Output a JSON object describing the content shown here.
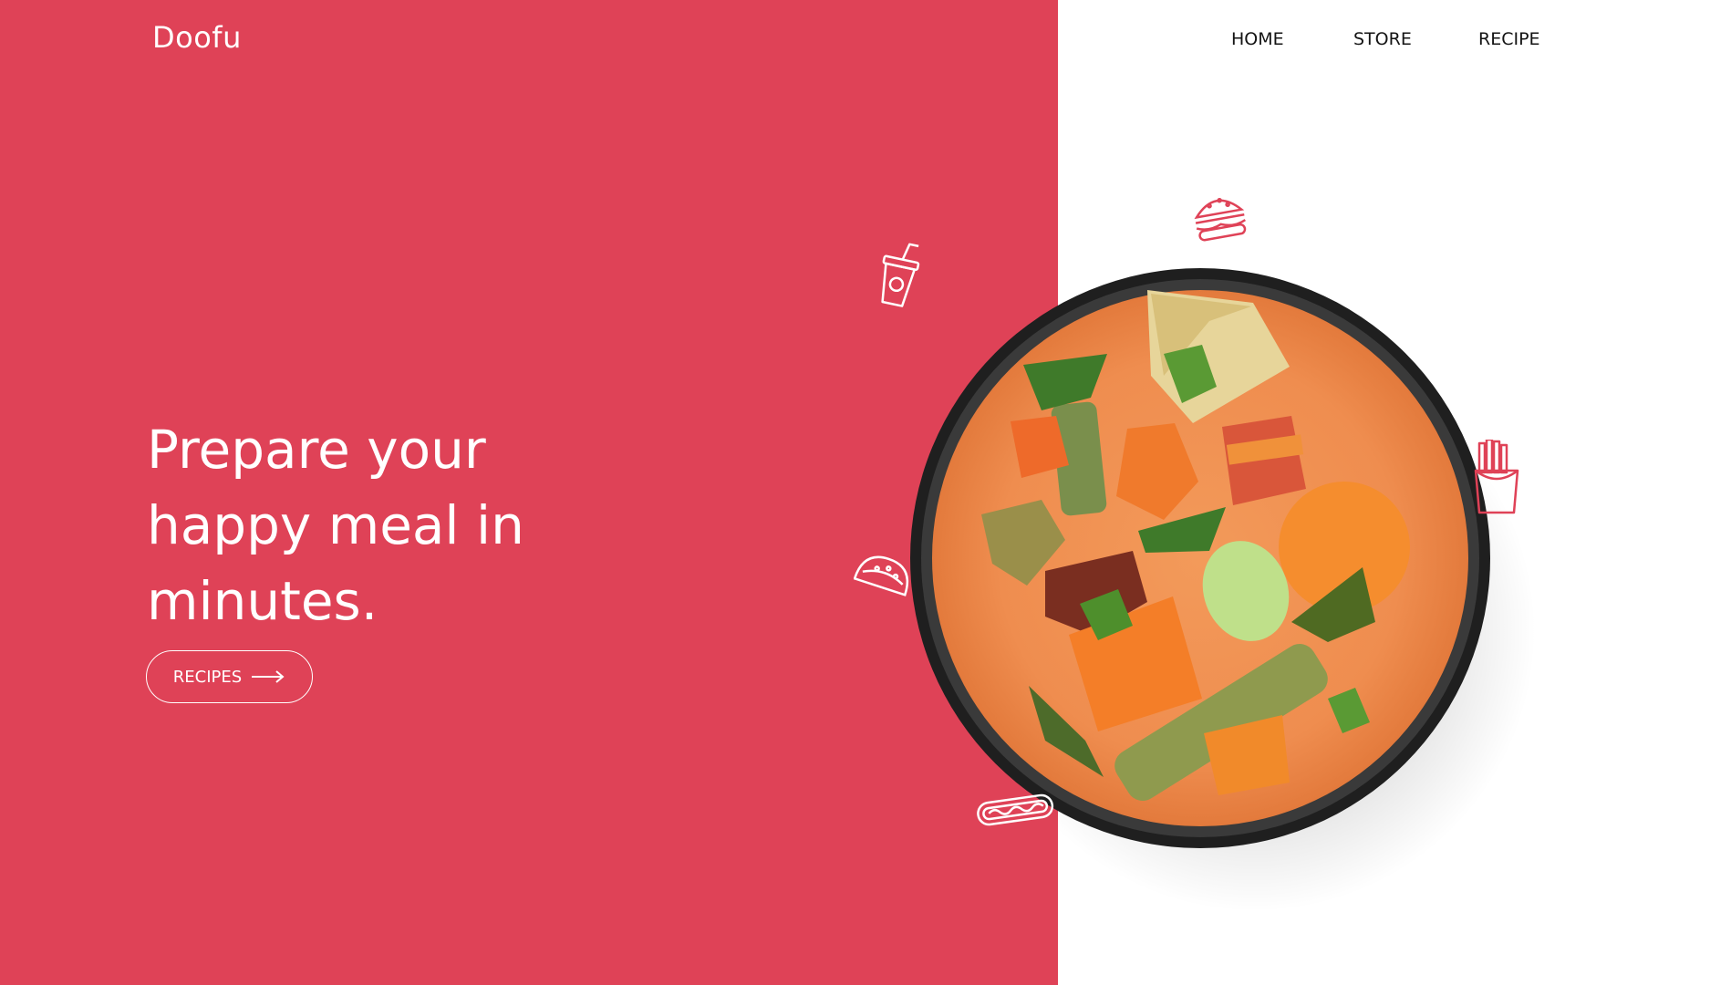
{
  "brand": {
    "name": "Doofu"
  },
  "nav": {
    "items": [
      "HOME",
      "STORE",
      "RECIPE"
    ]
  },
  "hero": {
    "headline_lines": [
      "Prepare your",
      "happy meal in",
      "minutes."
    ],
    "cta_label": "RECIPES"
  },
  "colors": {
    "accent": "#df4257",
    "panel_text": "#ffffff",
    "nav_text": "#141414",
    "icon_red": "#df4257"
  },
  "icons": [
    "cup-icon",
    "burger-icon",
    "fries-icon",
    "taco-icon",
    "hotdog-icon",
    "arrow-right-icon"
  ],
  "image": {
    "subject": "bowl of vegetable curry"
  }
}
